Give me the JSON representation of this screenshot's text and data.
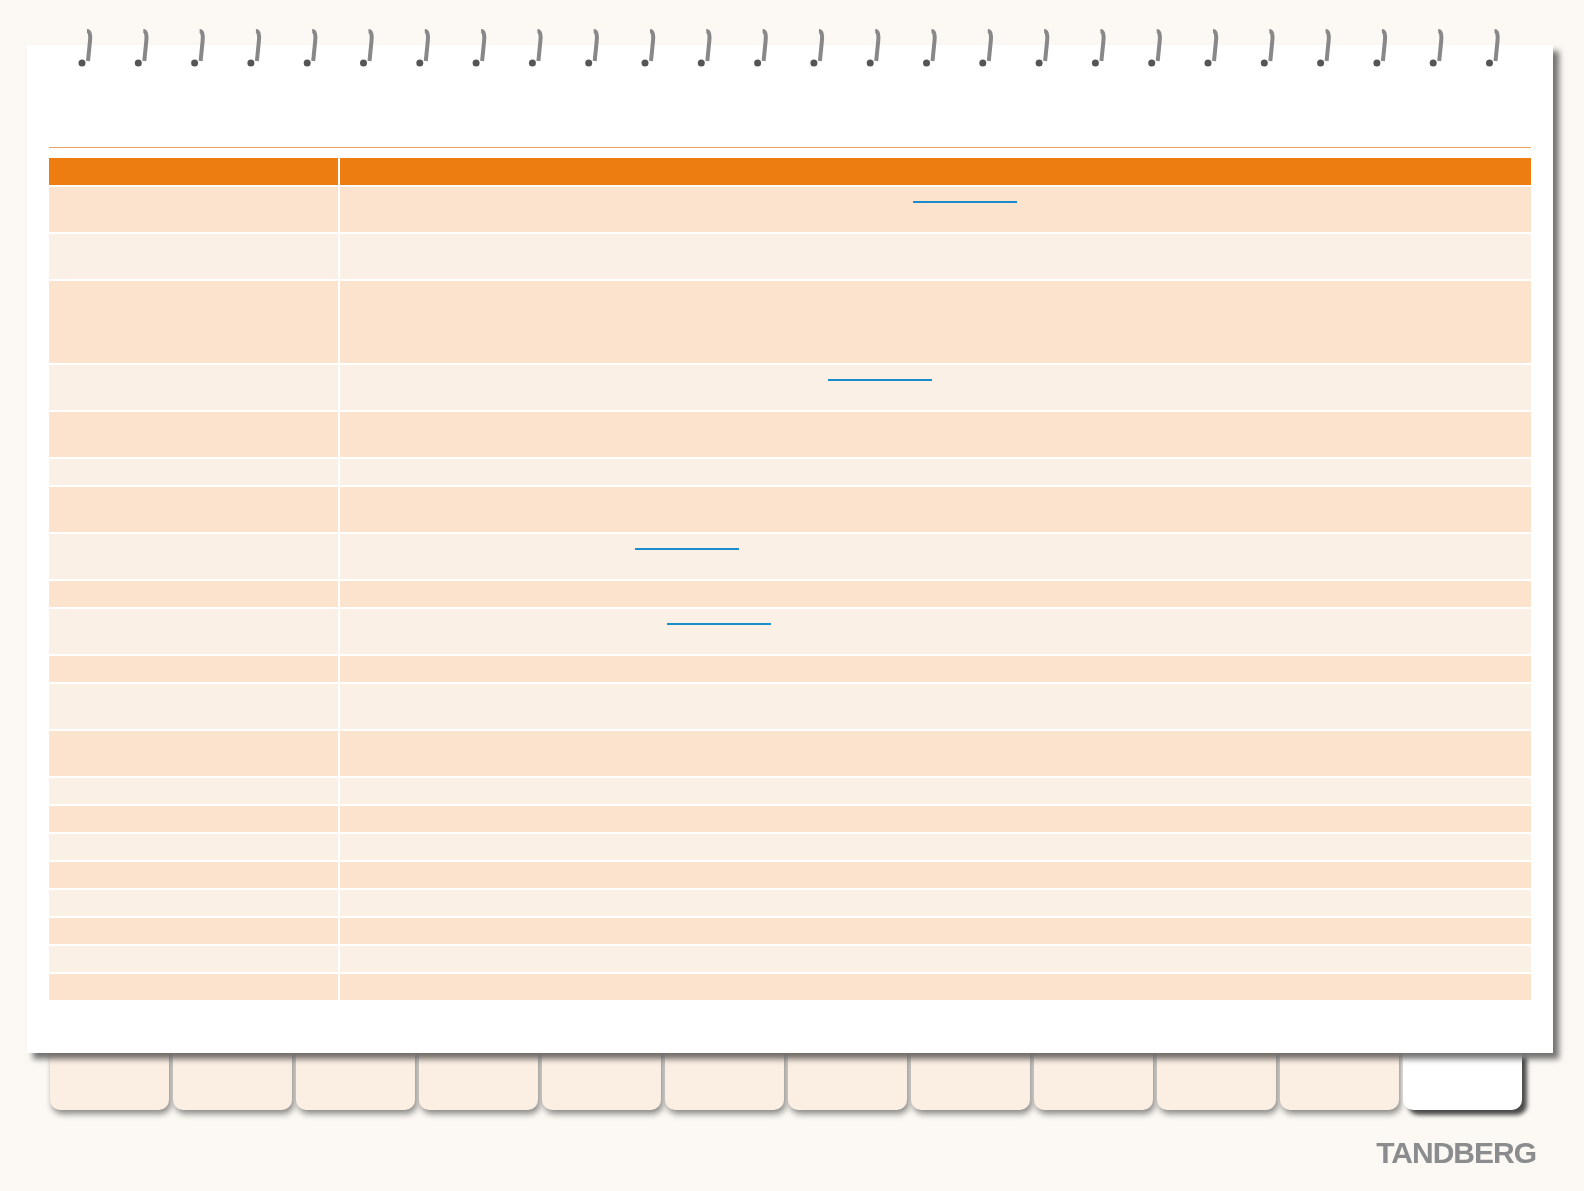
{
  "table": {
    "rows": [
      {
        "kind": "double",
        "link": true
      },
      {
        "kind": "double",
        "link": false
      },
      {
        "kind": "triple",
        "link": false
      },
      {
        "kind": "double",
        "link": true
      },
      {
        "kind": "double",
        "link": false
      },
      {
        "kind": "single",
        "link": false
      },
      {
        "kind": "double",
        "link": false
      },
      {
        "kind": "double",
        "link": true
      },
      {
        "kind": "single",
        "link": false
      },
      {
        "kind": "double",
        "link": true
      },
      {
        "kind": "single",
        "link": false
      },
      {
        "kind": "double",
        "link": false
      },
      {
        "kind": "double",
        "link": false
      },
      {
        "kind": "single",
        "link": false
      },
      {
        "kind": "single",
        "link": false
      },
      {
        "kind": "single",
        "link": false
      },
      {
        "kind": "single",
        "link": false
      },
      {
        "kind": "single",
        "link": false
      },
      {
        "kind": "single",
        "link": false
      },
      {
        "kind": "single",
        "link": false
      },
      {
        "kind": "single",
        "link": false
      }
    ]
  },
  "tabs": [
    {
      "selected": false
    },
    {
      "selected": false
    },
    {
      "selected": false
    },
    {
      "selected": false
    },
    {
      "selected": false
    },
    {
      "selected": false
    },
    {
      "selected": false
    },
    {
      "selected": false
    },
    {
      "selected": false
    },
    {
      "selected": false
    },
    {
      "selected": false
    },
    {
      "selected": true
    }
  ],
  "logo": "TANDBERG"
}
